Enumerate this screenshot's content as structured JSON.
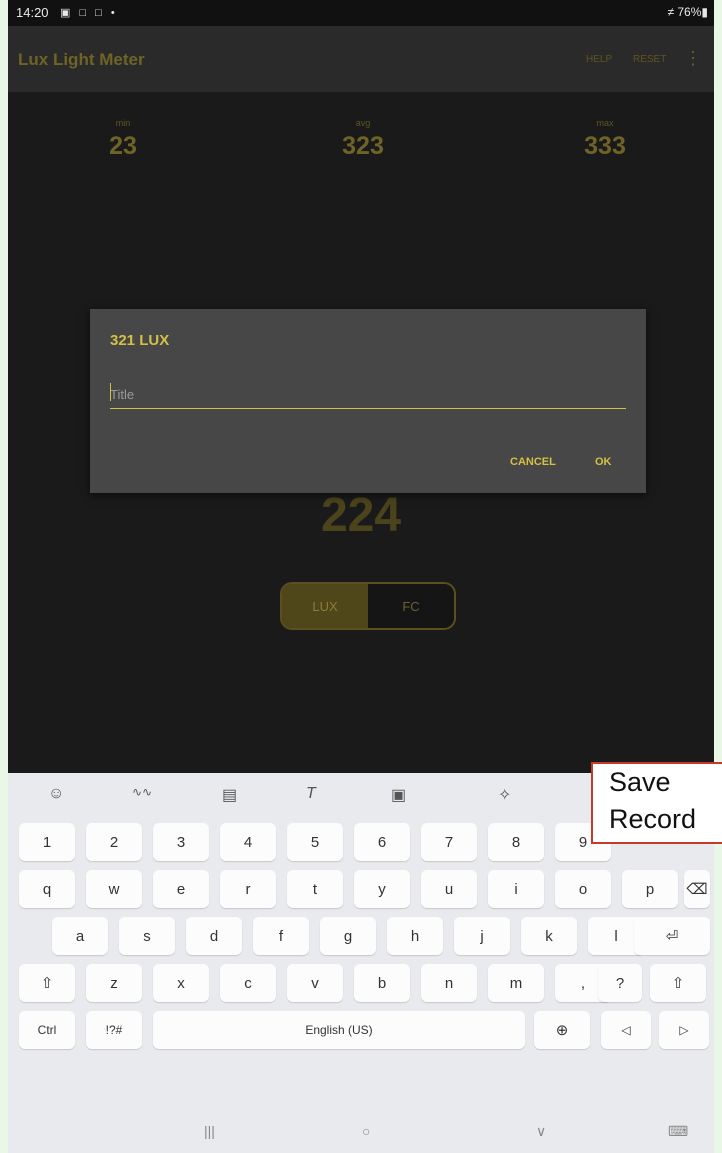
{
  "status_bar": {
    "time": "14:20",
    "icons": "▣ □ □ •",
    "battery": "≠ 76%▮"
  },
  "app_bar": {
    "title": "Lux Light Meter",
    "help": "HELP",
    "reset": "RESET",
    "more": "⋮"
  },
  "stats": {
    "min": {
      "label": "min",
      "value": "23"
    },
    "avg": {
      "label": "avg",
      "value": "323"
    },
    "max": {
      "label": "max",
      "value": "333"
    }
  },
  "current_reading": "224",
  "unit_toggle": {
    "lux": "LUX",
    "fc": "FC",
    "selected": "LUX"
  },
  "dialog": {
    "title": "321 LUX",
    "placeholder": "Title",
    "value": "",
    "cancel": "CANCEL",
    "ok": "OK"
  },
  "keyboard": {
    "toolbar": [
      "☺",
      "∿∿",
      "▤",
      "T",
      "▣",
      "✧"
    ],
    "row_numbers": [
      "1",
      "2",
      "3",
      "4",
      "5",
      "6",
      "7",
      "8",
      "9"
    ],
    "row_q": [
      "q",
      "w",
      "e",
      "r",
      "t",
      "y",
      "u",
      "i",
      "o",
      "p",
      "⌫"
    ],
    "row_q_hints": [
      "",
      "",
      "",
      "",
      "",
      "",
      "",
      "",
      "",
      "",
      ""
    ],
    "row_a": [
      "a",
      "s",
      "d",
      "f",
      "g",
      "h",
      "j",
      "k",
      "l",
      "⏎"
    ],
    "row_a_hints": [
      "",
      "",
      "(",
      ")",
      "",
      "#",
      "\\",
      "",
      ""
    ],
    "row_z": [
      "⇧",
      "z",
      "x",
      "c",
      "v",
      "b",
      "n",
      "m",
      ",",
      "?",
      "⇧"
    ],
    "row_z_hints": [
      "",
      "",
      "",
      "",
      "",
      "",
      "",
      "",
      "!",
      "",
      ""
    ],
    "bottom": {
      "ctrl": "Ctrl",
      "sym": "!?#",
      "space": "English (US)",
      "globe": "⊕",
      "left": "◁",
      "right": "▷"
    },
    "nav": {
      "recents": "|||",
      "home": "○",
      "back": "∨",
      "keyboard": "⌨"
    }
  },
  "callout": {
    "line1": "Save",
    "line2": "Record"
  }
}
